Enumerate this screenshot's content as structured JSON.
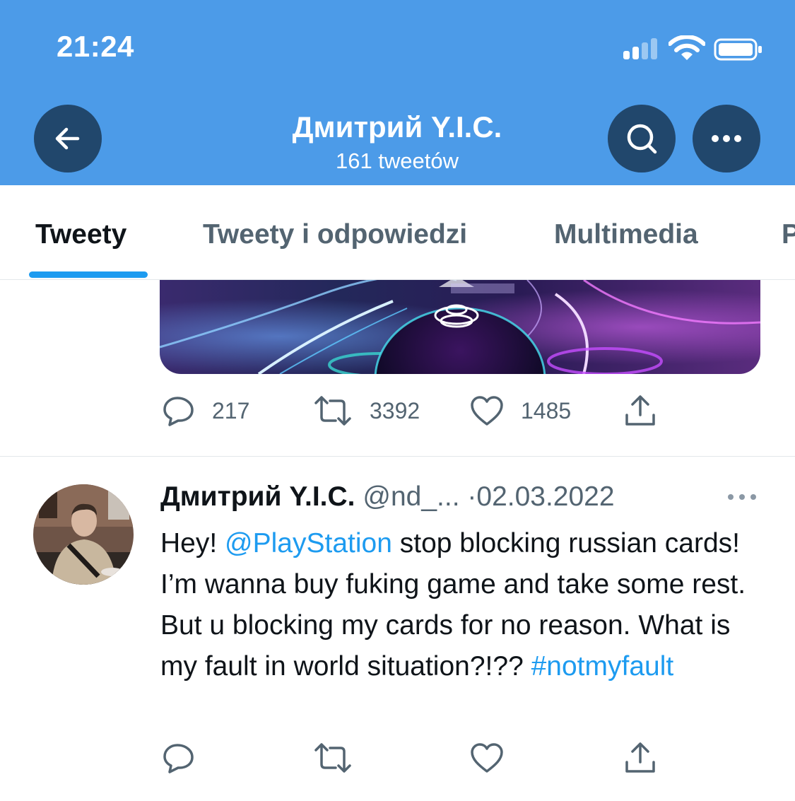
{
  "status_bar": {
    "time": "21:24"
  },
  "header": {
    "title": "Дмитрий Y.I.C.",
    "subtitle": "161 tweetów",
    "icons": {
      "back": "arrow-left-icon",
      "search": "search-icon",
      "more": "more-horizontal-icon"
    }
  },
  "tabs": [
    {
      "label": "Tweety",
      "active": true
    },
    {
      "label": "Tweety i odpowiedzi",
      "active": false
    },
    {
      "label": "Multimedia",
      "active": false
    },
    {
      "label": "P",
      "active": false
    }
  ],
  "prev_tweet": {
    "replies": "217",
    "retweets": "3392",
    "likes": "1485"
  },
  "tweet": {
    "author_name": "Дмитрий Y.I.C.",
    "handle": "@nd_...",
    "separator": "·",
    "date": "02.03.2022",
    "text_before_mention": "Hey! ",
    "mention": "@PlayStation",
    "text_after_mention": " stop blocking russian cards! I’m wanna buy fuking game and take some rest. But u blocking my cards for no reason. What is my fault in world situation?!?? ",
    "hashtag": "#notmyfault"
  },
  "colors": {
    "header_bg": "#4c9be8",
    "header_button_bg": "#21476c",
    "accent": "#1d9bf0",
    "secondary_text": "#536471"
  }
}
